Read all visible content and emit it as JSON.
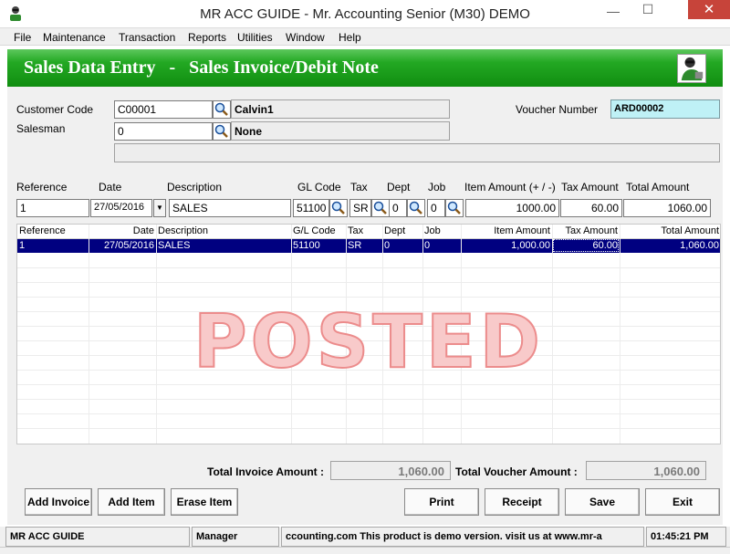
{
  "window": {
    "title": "MR ACC GUIDE - Mr. Accounting Senior (M30) DEMO",
    "close_glyph": "✕",
    "minimize_glyph": "—",
    "maximize_glyph": "☐"
  },
  "menu": [
    "File",
    "Maintenance",
    "Transaction",
    "Reports",
    "Utilities",
    "Window",
    "Help"
  ],
  "header": {
    "title": "Sales Data Entry   -   Sales Invoice/Debit Note",
    "icon": "user-icon",
    "accent_color": "#1a9e1a"
  },
  "customer": {
    "code_label": "Customer Code",
    "code": "C00001",
    "name": "Calvin1",
    "salesman_label": "Salesman",
    "salesman_code": "0",
    "salesman_name": "None",
    "remarks": ""
  },
  "voucher": {
    "label": "Voucher Number",
    "number": "ARD00002"
  },
  "entry": {
    "headers": [
      "Reference",
      "Date",
      "Description",
      "GL Code",
      "Tax",
      "Dept",
      "Job",
      "Item Amount (+ / -)",
      "Tax Amount",
      "Total Amount"
    ],
    "reference": "1",
    "date": "27/05/2016",
    "description": "SALES",
    "gl_code": "51100",
    "tax": "SR",
    "dept": "0",
    "job": "0",
    "item_amount": "1000.00",
    "tax_amount": "60.00",
    "total_amount": "1060.00"
  },
  "grid": {
    "columns": [
      "Reference",
      "Date",
      "Description",
      "G/L Code",
      "Tax",
      "Dept",
      "Job",
      "Item Amount",
      "Tax Amount",
      "Total Amount"
    ],
    "rows": [
      [
        "1",
        "27/05/2016",
        "SALES",
        "51100",
        "SR",
        "0",
        "0",
        "1,000.00",
        "60.00",
        "1,060.00"
      ]
    ],
    "watermark": "POSTED"
  },
  "totals": {
    "invoice_label": "Total Invoice Amount :",
    "invoice_amount": "1,060.00",
    "voucher_label": "Total  Voucher Amount :",
    "voucher_amount": "1,060.00"
  },
  "buttons": {
    "add_invoice": "Add Invoice",
    "add_item": "Add Item",
    "erase_item": "Erase Item",
    "print": "Print",
    "receipt": "Receipt",
    "save": "Save",
    "exit": "Exit"
  },
  "status": {
    "app": "MR ACC GUIDE",
    "user": "Manager",
    "message": "ccounting.com This product is demo version.  visit us at www.mr-a",
    "time": "01:45:21 PM"
  }
}
